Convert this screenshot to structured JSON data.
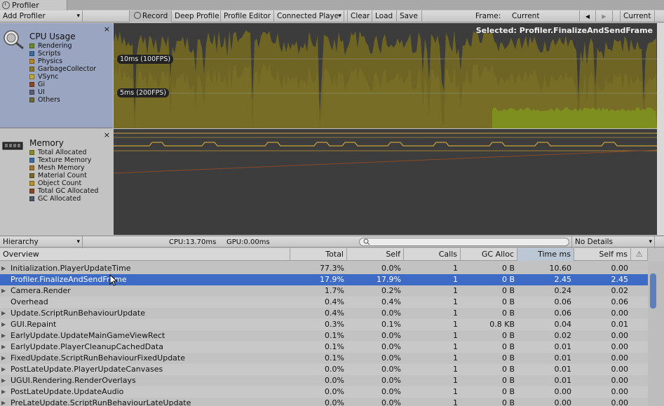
{
  "window": {
    "tab_title": "Profiler"
  },
  "toolbar": {
    "add_profiler": "Add Profiler",
    "record": "Record",
    "deep_profile": "Deep Profile",
    "profile_editor": "Profile Editor",
    "connected_player": "Connected Playe",
    "clear": "Clear",
    "load": "Load",
    "save": "Save",
    "frame_label": "Frame:",
    "frame_value": "Current",
    "prev_frame": "◀",
    "next_frame": "▶",
    "current_button": "Current"
  },
  "cpu_panel": {
    "title": "CPU Usage",
    "items": [
      {
        "label": "Rendering",
        "color": "#6b8a2c"
      },
      {
        "label": "Scripts",
        "color": "#3a6fa2"
      },
      {
        "label": "Physics",
        "color": "#b8842c"
      },
      {
        "label": "GarbageCollector",
        "color": "#8a7a2a"
      },
      {
        "label": "VSync",
        "color": "#c2a93b"
      },
      {
        "label": "Gi",
        "color": "#8a4a2a"
      },
      {
        "label": "UI",
        "color": "#5b5b7a"
      },
      {
        "label": "Others",
        "color": "#6b6b3a"
      }
    ],
    "marker_10ms": "10ms (100FPS)",
    "marker_5ms": "5ms (200FPS)",
    "selected_text": "Selected: Profiler.FinalizeAndSendFrame",
    "close": "×"
  },
  "memory_panel": {
    "title": "Memory",
    "items": [
      {
        "label": "Total Allocated",
        "color": "#8e8a2a"
      },
      {
        "label": "Texture Memory",
        "color": "#3a6fa2"
      },
      {
        "label": "Mesh Memory",
        "color": "#a07a2a"
      },
      {
        "label": "Material Count",
        "color": "#7a6a2a"
      },
      {
        "label": "Object Count",
        "color": "#b8942c"
      },
      {
        "label": "Total GC Allocated",
        "color": "#8a4a2a"
      },
      {
        "label": "GC Allocated",
        "color": "#4a5a6a"
      }
    ],
    "close": "×"
  },
  "hierarchy_bar": {
    "view_mode": "Hierarchy",
    "cpu_time": "CPU:13.70ms",
    "gpu_time": "GPU:0.00ms",
    "details_mode": "No Details"
  },
  "table": {
    "headers": [
      "Overview",
      "Total",
      "Self",
      "Calls",
      "GC Alloc",
      "Time ms",
      "Self ms",
      "⚠"
    ],
    "rows": [
      {
        "name": "Initialization.PlayerUpdateTime",
        "total": "77.3%",
        "self": "0.0%",
        "calls": "1",
        "gc": "0 B",
        "time": "10.60",
        "selfms": "0.00",
        "expandable": "▶"
      },
      {
        "name": "Profiler.FinalizeAndSendFrame",
        "total": "17.9%",
        "self": "17.9%",
        "calls": "1",
        "gc": "0 B",
        "time": "2.45",
        "selfms": "2.45",
        "expandable": ""
      },
      {
        "name": "Camera.Render",
        "total": "1.7%",
        "self": "0.2%",
        "calls": "1",
        "gc": "0 B",
        "time": "0.24",
        "selfms": "0.02",
        "expandable": "▶"
      },
      {
        "name": "Overhead",
        "total": "0.4%",
        "self": "0.4%",
        "calls": "1",
        "gc": "0 B",
        "time": "0.06",
        "selfms": "0.06",
        "expandable": ""
      },
      {
        "name": "Update.ScriptRunBehaviourUpdate",
        "total": "0.4%",
        "self": "0.0%",
        "calls": "1",
        "gc": "0 B",
        "time": "0.06",
        "selfms": "0.00",
        "expandable": "▶"
      },
      {
        "name": "GUI.Repaint",
        "total": "0.3%",
        "self": "0.1%",
        "calls": "1",
        "gc": "0.8 KB",
        "time": "0.04",
        "selfms": "0.01",
        "expandable": "▶"
      },
      {
        "name": "EarlyUpdate.UpdateMainGameViewRect",
        "total": "0.1%",
        "self": "0.0%",
        "calls": "1",
        "gc": "0 B",
        "time": "0.02",
        "selfms": "0.00",
        "expandable": "▶"
      },
      {
        "name": "EarlyUpdate.PlayerCleanupCachedData",
        "total": "0.1%",
        "self": "0.0%",
        "calls": "1",
        "gc": "0 B",
        "time": "0.01",
        "selfms": "0.00",
        "expandable": "▶"
      },
      {
        "name": "FixedUpdate.ScriptRunBehaviourFixedUpdate",
        "total": "0.1%",
        "self": "0.0%",
        "calls": "1",
        "gc": "0 B",
        "time": "0.01",
        "selfms": "0.00",
        "expandable": "▶"
      },
      {
        "name": "PostLateUpdate.PlayerUpdateCanvases",
        "total": "0.0%",
        "self": "0.0%",
        "calls": "1",
        "gc": "0 B",
        "time": "0.01",
        "selfms": "0.00",
        "expandable": "▶"
      },
      {
        "name": "UGUI.Rendering.RenderOverlays",
        "total": "0.0%",
        "self": "0.0%",
        "calls": "1",
        "gc": "0 B",
        "time": "0.01",
        "selfms": "0.00",
        "expandable": "▶"
      },
      {
        "name": "PostLateUpdate.UpdateAudio",
        "total": "0.0%",
        "self": "0.0%",
        "calls": "1",
        "gc": "0 B",
        "time": "0.00",
        "selfms": "0.00",
        "expandable": "▶"
      },
      {
        "name": "PreLateUpdate.ScriptRunBehaviourLateUpdate",
        "total": "0.0%",
        "self": "0.0%",
        "calls": "1",
        "gc": "0 B",
        "time": "0.00",
        "selfms": "0.00",
        "expandable": "▶"
      }
    ]
  },
  "colors": {
    "cpu_fill": "#6e6424",
    "cpu_fill_light": "#8a7f2c",
    "cpu_green": "#7f8f1f",
    "mem_line": "#c7a23a",
    "mem_line_dark": "#8a4a2a",
    "selection": "#3e6bc6"
  }
}
